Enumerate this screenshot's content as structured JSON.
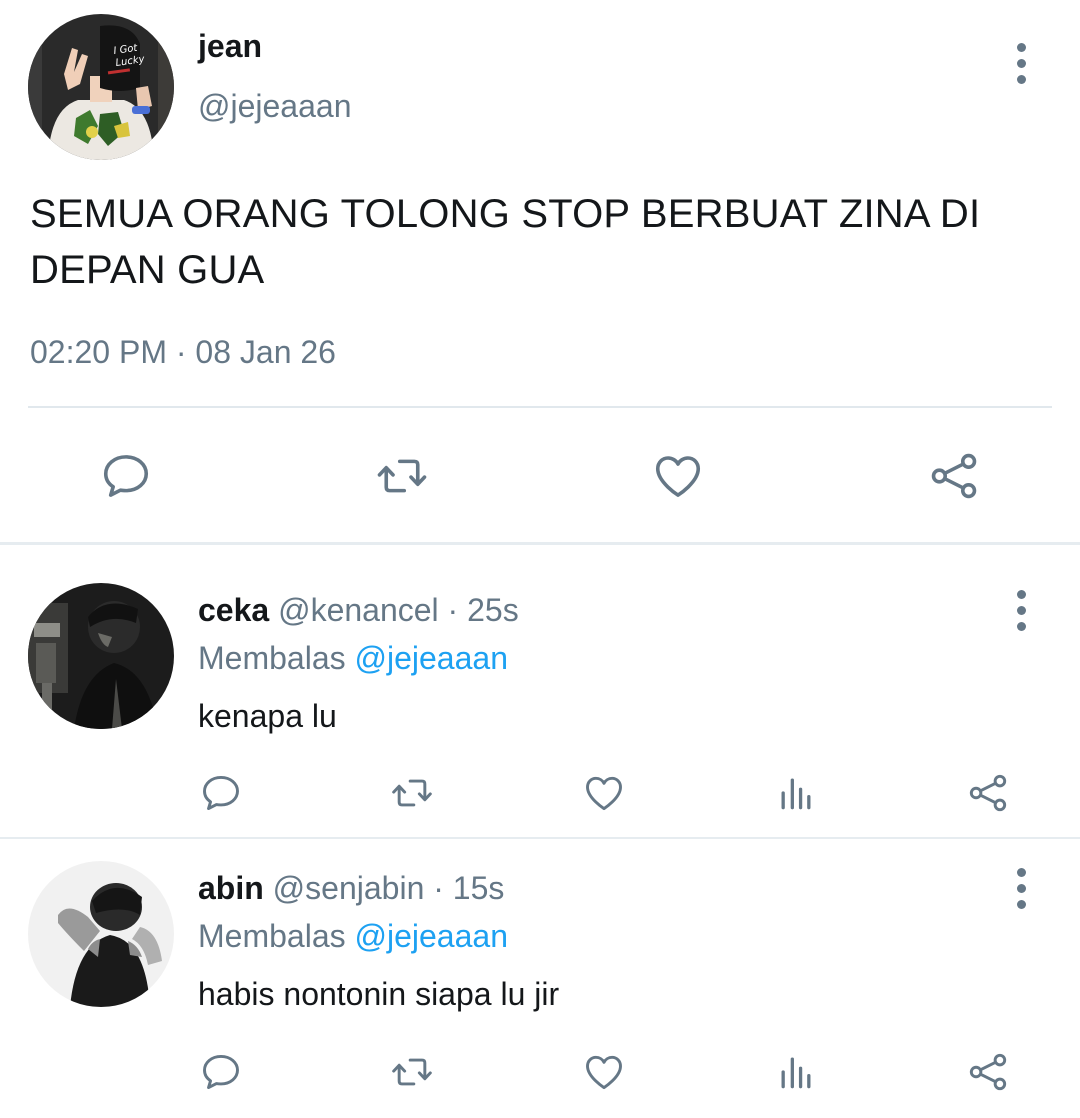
{
  "main_tweet": {
    "author_name": "jean",
    "author_handle": "@jejeaaan",
    "text": "SEMUA ORANG TOLONG STOP BERBUAT ZINA DI DEPAN GUA",
    "timestamp": "02:20 PM · 08 Jan 26",
    "cap_text": "I Got Lucky"
  },
  "replies": [
    {
      "name": "ceka",
      "handle": "@kenancel",
      "separator": "·",
      "time": "25s",
      "replying_label": "Membalas",
      "replying_to": "@jejeaaan",
      "text": "kenapa lu"
    },
    {
      "name": "abin",
      "handle": "@senjabin",
      "separator": "·",
      "time": "15s",
      "replying_label": "Membalas",
      "replying_to": "@jejeaaan",
      "text": "habis nontonin siapa lu jir"
    }
  ],
  "icons": {
    "reply": "comment-icon",
    "retweet": "retweet-icon",
    "like": "heart-icon",
    "views": "analytics-icon",
    "share": "share-icon",
    "more": "more-vertical-icon"
  },
  "colors": {
    "text_primary": "#14171a",
    "text_secondary": "#657786",
    "link": "#1da1f2",
    "divider": "#e1e8ed",
    "background": "#ffffff"
  }
}
